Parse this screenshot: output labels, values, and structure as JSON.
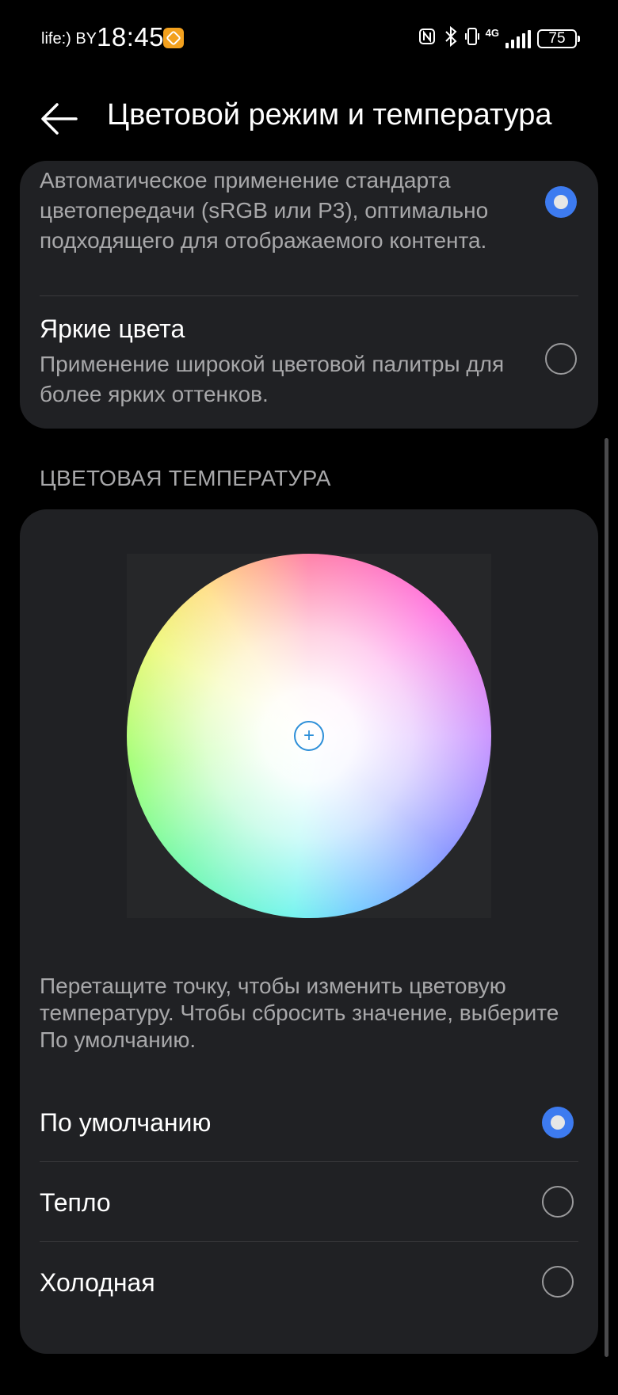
{
  "status_bar": {
    "carrier": "life:) BY",
    "time": "18:45",
    "network_label": "4G",
    "battery": "75",
    "icons": [
      "app-notification-icon",
      "nfc-icon",
      "bluetooth-icon",
      "vibrate-icon",
      "signal-icon",
      "battery-icon"
    ]
  },
  "header": {
    "title": "Цветовой режим и температура",
    "back_icon": "arrow-left-icon"
  },
  "color_mode": {
    "items": [
      {
        "title": "",
        "description": "Автоматическое применение стандарта цветопередачи (sRGB или P3), оптимально подходящего для отображаемого контента.",
        "selected": true
      },
      {
        "title": "Яркие цвета",
        "description": "Применение широкой цветовой палитры для более ярких оттенков.",
        "selected": false
      }
    ]
  },
  "color_temperature": {
    "heading": "ЦВЕТОВАЯ ТЕМПЕРАТУРА",
    "wheel_handle_icon": "plus-icon",
    "hint": "Перетащите точку, чтобы изменить цветовую температуру. Чтобы сбросить значение, выберите По умолчанию.",
    "options": [
      {
        "label": "По умолчанию",
        "selected": true
      },
      {
        "label": "Тепло",
        "selected": false
      },
      {
        "label": "Холодная",
        "selected": false
      }
    ]
  },
  "colors": {
    "background": "#000000",
    "card": "#202124",
    "accent": "#3d7bf0",
    "secondary_text": "#a8a8aa"
  }
}
